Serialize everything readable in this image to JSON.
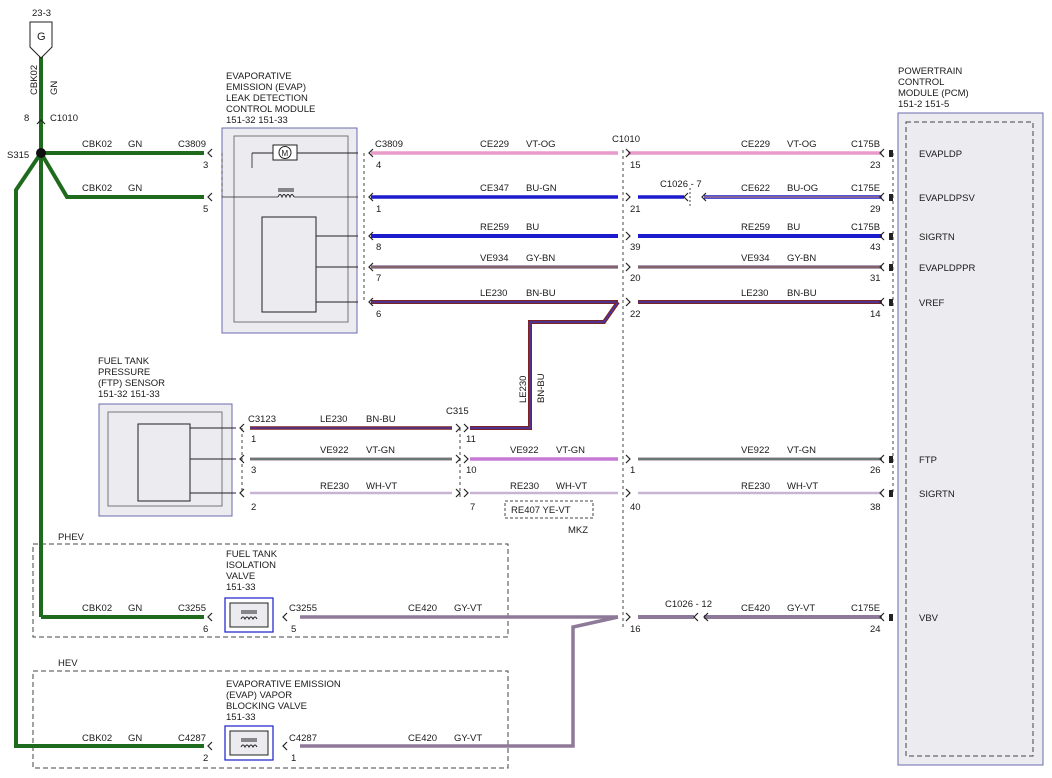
{
  "ground": {
    "ref": "23-3",
    "symbol": "G",
    "vertical_circuit": "CBK02",
    "vertical_color": "GN",
    "pin": "8",
    "connector": "C1010",
    "splice": "S315"
  },
  "evap_module": {
    "title": [
      "EVAPORATIVE",
      "EMISSION (EVAP)",
      "LEAK DETECTION",
      "CONTROL MODULE",
      "151-32  151-33"
    ],
    "connector": "C3809"
  },
  "ftp_sensor": {
    "title": [
      "FUEL TANK",
      "PRESSURE",
      "(FTP) SENSOR",
      "151-32  151-33"
    ],
    "connector": "C3123",
    "connector_mid": "C315"
  },
  "pcm": {
    "title": [
      "POWERTRAIN",
      "CONTROL",
      "MODULE (PCM)",
      "151-2  151-5"
    ],
    "pins": [
      "EVAPLDP",
      "EVAPLDPSV",
      "SIGRTN",
      "EVAPLDPPR",
      "VREF",
      "FTP",
      "SIGRTN",
      "VBV"
    ]
  },
  "main_connector": "C1010",
  "evap_left": [
    {
      "circuit": "CBK02",
      "color": "GN",
      "connector": "C3809",
      "pin": "3"
    },
    {
      "circuit": "CBK02",
      "color": "GN",
      "connector": "",
      "pin": "5"
    }
  ],
  "rows": [
    {
      "mod_pin": "4",
      "c_left": "C3809",
      "circ1": "CE229",
      "col1": "VT-OG",
      "c1010_pin": "15",
      "mid_conn": "",
      "circ2": "CE229",
      "col2": "VT-OG",
      "pcm_conn": "C175B",
      "pcm_pin": "23"
    },
    {
      "mod_pin": "1",
      "c_left": "",
      "circ1": "CE347",
      "col1": "BU-GN",
      "c1010_pin": "21",
      "mid_conn": "C1026  -  7",
      "circ2": "CE622",
      "col2": "BU-OG",
      "pcm_conn": "C175E",
      "pcm_pin": "29"
    },
    {
      "mod_pin": "8",
      "c_left": "",
      "circ1": "RE259",
      "col1": "BU",
      "c1010_pin": "39",
      "mid_conn": "",
      "circ2": "RE259",
      "col2": "BU",
      "pcm_conn": "C175B",
      "pcm_pin": "43"
    },
    {
      "mod_pin": "7",
      "c_left": "",
      "circ1": "VE934",
      "col1": "GY-BN",
      "c1010_pin": "20",
      "mid_conn": "",
      "circ2": "VE934",
      "col2": "GY-BN",
      "pcm_conn": "",
      "pcm_pin": "31"
    },
    {
      "mod_pin": "6",
      "c_left": "",
      "circ1": "LE230",
      "col1": "BN-BU",
      "c1010_pin": "22",
      "mid_conn": "",
      "circ2": "LE230",
      "col2": "BN-BU",
      "pcm_conn": "",
      "pcm_pin": "14"
    }
  ],
  "ftp_rows": [
    {
      "pin_left": "1",
      "circ1": "LE230",
      "col1": "BN-BU",
      "pin_mid": "11",
      "circ2": "",
      "col2": "",
      "c1010_pin": "",
      "circ3": "",
      "col3": "",
      "pcm_pin": ""
    },
    {
      "pin_left": "3",
      "circ1": "VE922",
      "col1": "VT-GN",
      "pin_mid": "10",
      "circ2": "VE922",
      "col2": "VT-GN",
      "c1010_pin": "1",
      "circ3": "VE922",
      "col3": "VT-GN",
      "pcm_pin": "26"
    },
    {
      "pin_left": "2",
      "circ1": "RE230",
      "col1": "WH-VT",
      "pin_mid": "7",
      "circ2": "RE230",
      "col2": "WH-VT",
      "c1010_pin": "40",
      "circ3": "RE230",
      "col3": "WH-VT",
      "pcm_pin": "38"
    }
  ],
  "riser": {
    "circuit": "LE230",
    "color": "BN-BU"
  },
  "alt_note": {
    "text": "RE407  YE-VT",
    "variant": "MKZ"
  },
  "phev": {
    "label": "PHEV",
    "title": [
      "FUEL TANK",
      "ISOLATION",
      "VALVE",
      "151-33"
    ],
    "left_circ": "CBK02",
    "left_col": "GN",
    "left_conn": "C3255",
    "left_pin": "6",
    "right_conn": "C3255",
    "right_pin": "5",
    "circ": "CE420",
    "col": "GY-VT",
    "c1010_pin": "16",
    "mid_conn": "C1026  -  12",
    "circ2": "CE420",
    "col2": "GY-VT",
    "pcm_conn": "C175E",
    "pcm_pin": "24"
  },
  "hev": {
    "label": "HEV",
    "title": [
      "EVAPORATIVE EMISSION",
      "(EVAP) VAPOR",
      "BLOCKING VALVE",
      "151-33"
    ],
    "left_circ": "CBK02",
    "left_col": "GN",
    "left_conn": "C4287",
    "left_pin": "2",
    "right_conn": "C4287",
    "right_pin": "1",
    "circ": "CE420",
    "col": "GY-VT"
  },
  "colors": {
    "green": "#1e6b1e",
    "pink": "#e89ac8",
    "blue": "#1c1ccc",
    "grey_violet": "#8e7a98",
    "brown": "#7a2525",
    "violet": "#c779d6",
    "box_border": "#6b6bb0",
    "box_fill": "#ebebf0"
  }
}
